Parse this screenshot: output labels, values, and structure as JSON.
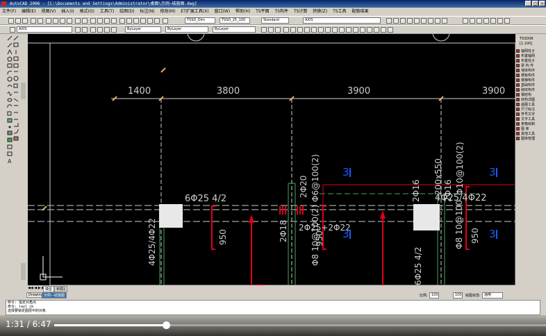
{
  "window": {
    "title": "AutoCAD 2006 - [C:\\Documents and Settings\\Administrator\\桌面\\示例—结施图.dwg]"
  },
  "menu": [
    "文件(F)",
    "编辑(E)",
    "视图(V)",
    "插入(I)",
    "格式(O)",
    "工具(T)",
    "绘图(D)",
    "标注(N)",
    "修改(M)",
    "ET扩展工具(X)",
    "窗口(W)",
    "帮助(H)",
    "TS平面",
    "TS构件",
    "TS计算",
    "转换(Z)",
    "TS工具",
    "配筋结果"
  ],
  "toolbar": {
    "style_combo": "TSSD_Dim",
    "dimstyle_combo": "TSSD_25_100",
    "textstyle_combo": "Standard",
    "layer_combo": "AXIS",
    "layer_combo2": "AXIS",
    "color_combo": "ByLayer",
    "linetype_combo": "ByLayer",
    "lineweight_combo": "ByLayer"
  },
  "drawing": {
    "dims": [
      "1400",
      "3800",
      "3900",
      "3900"
    ],
    "labels": {
      "beam1": "6Φ25 4/2",
      "beam1_side": "4Φ25/4Φ22",
      "sec950a": "950",
      "col_2d20": "2Φ20",
      "col_phi6": "Φ6@100(2)",
      "col_2d18": "2Φ18",
      "beam2": "2Φ25+2Φ22",
      "sec950b": "950",
      "stirrup_b": "Φ8 10@100(2)",
      "sec_200x550": "200x550",
      "col_2d16": "2Φ16",
      "col_2d16b": "2Φ16",
      "stirrup_c": "Φ10@100(2)",
      "beam3": "4Φ25/4Φ22",
      "beam3_side": "6Φ25 4/2",
      "stirrup_d": "Φ8 10@100",
      "sec950c": "950",
      "mark_3a": "3",
      "mark_3b": "3",
      "mark_3c": "3",
      "mark_3d": "3"
    }
  },
  "right_panel": {
    "header1": "TSSD08",
    "header2": "[1.100]",
    "items": [
      "轴网柱子",
      "布置轴网",
      "布置柱子",
      "梁 构 件",
      "墙体构件",
      "楼板构件",
      "楼梯构件",
      "基础构件",
      "砌体构件",
      "钢结构",
      "结构详图",
      "画图工具",
      "尺寸标注",
      "符号文字",
      "文字工具",
      "表格绘制",
      "图 库",
      "其他工具",
      "图库管理"
    ]
  },
  "tabs": {
    "model": "模型",
    "layout1": "布局1",
    "sheet": "Drawing1",
    "file": "示例—结施图"
  },
  "statusbar": {
    "scale_label": "比例:",
    "scale_value": "100",
    "angle_value": "100",
    "state_label": "绘图状态:",
    "state_value": "通用"
  },
  "command": {
    "lines": [
      "命令: 指定对角点",
      "命令: layl ck",
      "选择要锁定图层中的对象"
    ]
  },
  "video": {
    "current": "1:31",
    "separator": "/",
    "total": "6:47",
    "progress": 0.23
  },
  "colors": {
    "canvas": "#000000",
    "rebar": "#e0001b",
    "mark": "#1e5bff",
    "dim_text": "#cfcfcf"
  }
}
